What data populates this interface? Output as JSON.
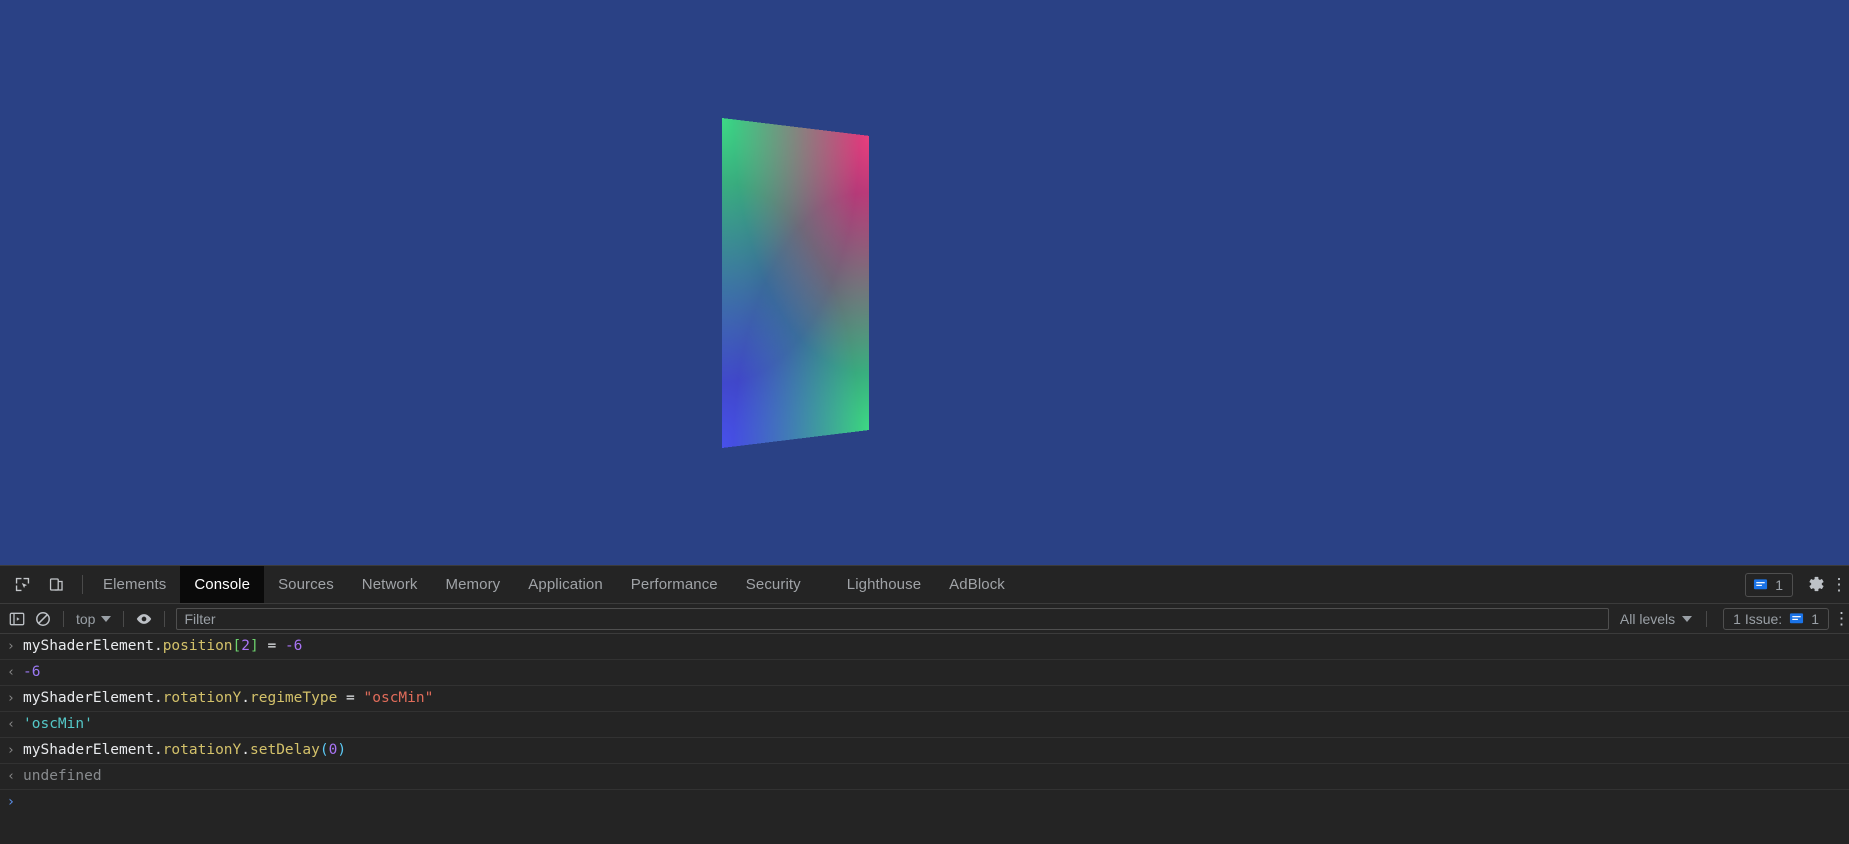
{
  "viewport": {
    "background_color": "#2a4185",
    "shader_element": {
      "name": "myShaderElement",
      "description": "3D rotated gradient quad",
      "corner_colors": {
        "top_left": "#18d630",
        "top_right": "#e81a22",
        "bottom_left": "#2430e2",
        "bottom_right": "#18d630"
      }
    }
  },
  "devtools": {
    "toolbar_icons": [
      {
        "name": "inspect-element-icon",
        "label": "Inspect element"
      },
      {
        "name": "device-toolbar-icon",
        "label": "Toggle device toolbar"
      }
    ],
    "tabs": [
      {
        "label": "Elements",
        "active": false
      },
      {
        "label": "Console",
        "active": true
      },
      {
        "label": "Sources",
        "active": false
      },
      {
        "label": "Network",
        "active": false
      },
      {
        "label": "Memory",
        "active": false
      },
      {
        "label": "Application",
        "active": false
      },
      {
        "label": "Performance",
        "active": false
      },
      {
        "label": "Security",
        "active": false
      },
      {
        "label": "Lighthouse",
        "active": false
      },
      {
        "label": "AdBlock",
        "active": false
      }
    ],
    "tabstrip_right": {
      "issues_count": "1",
      "gear_label": "Settings",
      "kebab_label": "More options"
    },
    "console_toolbar": {
      "sidebar_toggle_label": "Show console sidebar",
      "clear_label": "Clear console",
      "context_value": "top",
      "eye_label": "Create live expression",
      "filter_placeholder": "Filter",
      "filter_value": "",
      "levels_value": "All levels",
      "issues_label": "1 Issue:",
      "issues_count": "1",
      "kebab_label": "Console settings"
    },
    "messages": [
      {
        "kind": "input",
        "gutter": "›",
        "tokens": [
          {
            "text": "myShaderElement",
            "cls": "t-ident"
          },
          {
            "text": ".",
            "cls": "t-plain"
          },
          {
            "text": "position",
            "cls": "t-prop"
          },
          {
            "text": "[",
            "cls": "t-bracket"
          },
          {
            "text": "2",
            "cls": "t-numlit"
          },
          {
            "text": "]",
            "cls": "t-bracket"
          },
          {
            "text": " = ",
            "cls": "t-op"
          },
          {
            "text": "-6",
            "cls": "t-numlit"
          }
        ]
      },
      {
        "kind": "output",
        "gutter": "‹",
        "tokens": [
          {
            "text": "-6",
            "cls": "t-num"
          }
        ]
      },
      {
        "kind": "input",
        "gutter": "›",
        "tokens": [
          {
            "text": "myShaderElement",
            "cls": "t-ident"
          },
          {
            "text": ".",
            "cls": "t-plain"
          },
          {
            "text": "rotationY",
            "cls": "t-prop"
          },
          {
            "text": ".",
            "cls": "t-plain"
          },
          {
            "text": "regimeType",
            "cls": "t-prop"
          },
          {
            "text": " = ",
            "cls": "t-op"
          },
          {
            "text": "\"oscMin\"",
            "cls": "t-str"
          }
        ]
      },
      {
        "kind": "output",
        "gutter": "‹",
        "tokens": [
          {
            "text": "'oscMin'",
            "cls": "t-strret"
          }
        ]
      },
      {
        "kind": "input",
        "gutter": "›",
        "tokens": [
          {
            "text": "myShaderElement",
            "cls": "t-ident"
          },
          {
            "text": ".",
            "cls": "t-plain"
          },
          {
            "text": "rotationY",
            "cls": "t-prop"
          },
          {
            "text": ".",
            "cls": "t-plain"
          },
          {
            "text": "setDelay",
            "cls": "t-prop"
          },
          {
            "text": "(",
            "cls": "t-paren"
          },
          {
            "text": "0",
            "cls": "t-numlit"
          },
          {
            "text": ")",
            "cls": "t-paren"
          }
        ]
      },
      {
        "kind": "output",
        "gutter": "‹",
        "tokens": [
          {
            "text": "undefined",
            "cls": "t-undef"
          }
        ]
      }
    ],
    "prompt": {
      "arrow": "›",
      "value": ""
    }
  },
  "colors": {
    "accent_blue": "#1a73e8",
    "devtools_bg": "#242424",
    "active_tab_bg": "#0a0a0a",
    "border": "#3b3b3b",
    "muted_text": "#9aa0a6"
  }
}
